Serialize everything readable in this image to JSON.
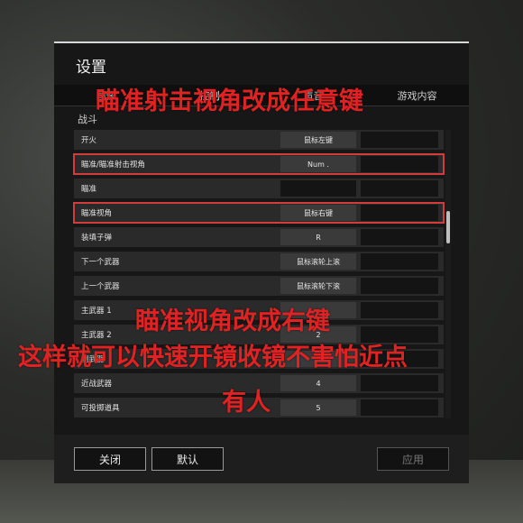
{
  "dialog": {
    "title": "设置"
  },
  "tabs": [
    {
      "label": "图像"
    },
    {
      "label": "控制"
    },
    {
      "label": "声音"
    },
    {
      "label": "游戏内容"
    }
  ],
  "section": {
    "title": "战斗"
  },
  "bindings": [
    {
      "action": "开火",
      "key1": "鼠标左键",
      "key2": ""
    },
    {
      "action": "瞄准/瞄准射击视角",
      "key1": "Num .",
      "key2": ""
    },
    {
      "action": "瞄准",
      "key1": "",
      "key2": ""
    },
    {
      "action": "瞄准视角",
      "key1": "鼠标右键",
      "key2": ""
    },
    {
      "action": "装填子弹",
      "key1": "R",
      "key2": ""
    },
    {
      "action": "下一个武器",
      "key1": "鼠标滚轮上滚",
      "key2": ""
    },
    {
      "action": "上一个武器",
      "key1": "鼠标滚轮下滚",
      "key2": ""
    },
    {
      "action": "主武器 1",
      "key1": "",
      "key2": ""
    },
    {
      "action": "主武器 2",
      "key1": "2",
      "key2": ""
    },
    {
      "action": "副武器",
      "key1": "",
      "key2": ""
    },
    {
      "action": "近战武器",
      "key1": "4",
      "key2": ""
    },
    {
      "action": "可投掷道具",
      "key1": "5",
      "key2": ""
    }
  ],
  "footer": {
    "close_label": "关闭",
    "default_label": "默认",
    "apply_label": "应用"
  },
  "annotations": {
    "top": "瞄准射击视角改成任意键",
    "middle": "瞄准视角改成右键",
    "bottom_line1": "这样就可以快速开镜收镜不害怕近点",
    "bottom_line2": "有人"
  },
  "colors": {
    "highlight": "#d43c3c",
    "annotation_text": "#e02222",
    "dialog_bg": "#171717"
  }
}
